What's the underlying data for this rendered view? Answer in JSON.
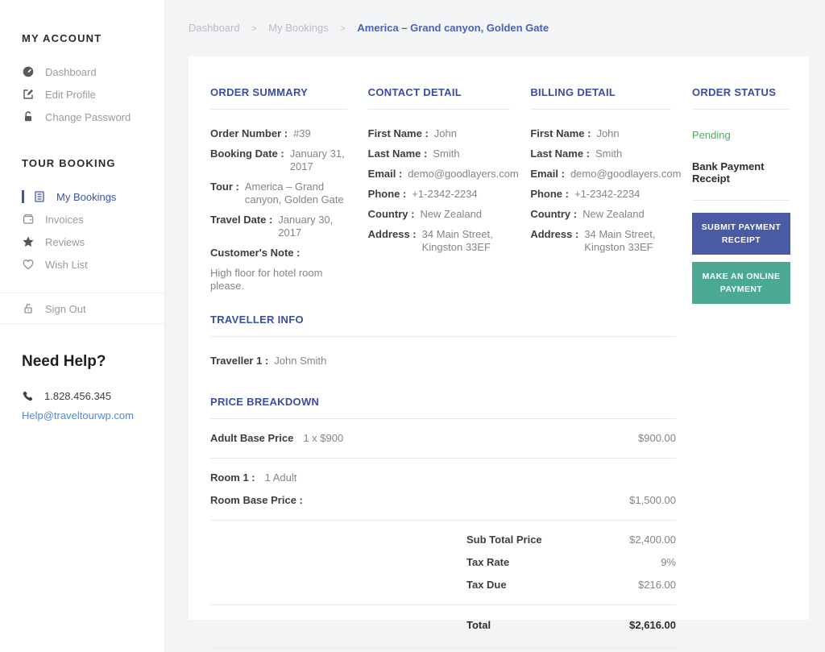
{
  "colors": {
    "accent_blue": "#3a4e9f",
    "link_blue": "#4e8ad8",
    "active_sidebar_blue": "#3d54a8",
    "pending_green": "#49b05b",
    "button_blue": "#4a5ba3",
    "button_teal": "#4ba893"
  },
  "sidebar": {
    "sections": [
      {
        "title": "MY ACCOUNT",
        "items": [
          {
            "label": "Dashboard"
          },
          {
            "label": "Edit Profile"
          },
          {
            "label": "Change Password"
          }
        ]
      },
      {
        "title": "TOUR BOOKING",
        "items": [
          {
            "label": "My Bookings"
          },
          {
            "label": "Invoices"
          },
          {
            "label": "Reviews"
          },
          {
            "label": "Wish List"
          }
        ]
      }
    ],
    "sign_out_label": "Sign Out",
    "help": {
      "title": "Need Help?",
      "phone": "1.828.456.345",
      "email": "Help@traveltourwp.com"
    }
  },
  "breadcrumb": {
    "separator": ">",
    "items": [
      "Dashboard",
      "My Bookings"
    ],
    "current": "America – Grand canyon, Golden Gate"
  },
  "order_summary": {
    "heading": "ORDER SUMMARY",
    "fields": [
      {
        "label": "Order Number :",
        "value": "#39"
      },
      {
        "label": "Booking Date :",
        "value": "January 31, 2017"
      },
      {
        "label": "Tour :",
        "value": "America – Grand canyon, Golden Gate"
      },
      {
        "label": "Travel Date :",
        "value": "January 30, 2017"
      }
    ],
    "note_label": "Customer's Note :",
    "note_text": "High floor for hotel room please."
  },
  "contact_detail": {
    "heading": "CONTACT DETAIL",
    "fields": [
      {
        "label": "First Name :",
        "value": "John"
      },
      {
        "label": "Last Name :",
        "value": "Smith"
      },
      {
        "label": "Email :",
        "value": "demo@goodlayers.com"
      },
      {
        "label": "Phone :",
        "value": "+1-2342-2234"
      },
      {
        "label": "Country :",
        "value": "New Zealand"
      },
      {
        "label": "Address :",
        "value": "34 Main Street, Kingston 33EF"
      }
    ]
  },
  "billing_detail": {
    "heading": "BILLING DETAIL",
    "fields": [
      {
        "label": "First Name :",
        "value": "John"
      },
      {
        "label": "Last Name :",
        "value": "Smith"
      },
      {
        "label": "Email :",
        "value": "demo@goodlayers.com"
      },
      {
        "label": "Phone :",
        "value": "+1-2342-2234"
      },
      {
        "label": "Country :",
        "value": "New Zealand"
      },
      {
        "label": "Address :",
        "value": "34 Main Street, Kingston 33EF"
      }
    ]
  },
  "order_status": {
    "heading": "ORDER STATUS",
    "status": "Pending",
    "receipt_label": "Bank Payment Receipt",
    "submit_button": "SUBMIT PAYMENT RECEIPT",
    "pay_button": "MAKE AN ONLINE PAYMENT"
  },
  "traveller_info": {
    "heading": "TRAVELLER INFO",
    "label": "Traveller 1 :",
    "value": "John Smith"
  },
  "price_breakdown": {
    "heading": "PRICE BREAKDOWN",
    "adult_row": {
      "label": "Adult Base Price",
      "detail": "1 x $900",
      "amount": "$900.00"
    },
    "room_row": {
      "label": "Room 1 :",
      "detail": "1 Adult"
    },
    "room_price_row": {
      "label": "Room Base Price :",
      "amount": "$1,500.00"
    },
    "summary": [
      {
        "label": "Sub Total Price",
        "amount": "$2,400.00"
      },
      {
        "label": "Tax Rate",
        "amount": "9%"
      },
      {
        "label": "Tax Due",
        "amount": "$216.00"
      }
    ],
    "total": {
      "label": "Total",
      "amount": "$2,616.00"
    }
  }
}
